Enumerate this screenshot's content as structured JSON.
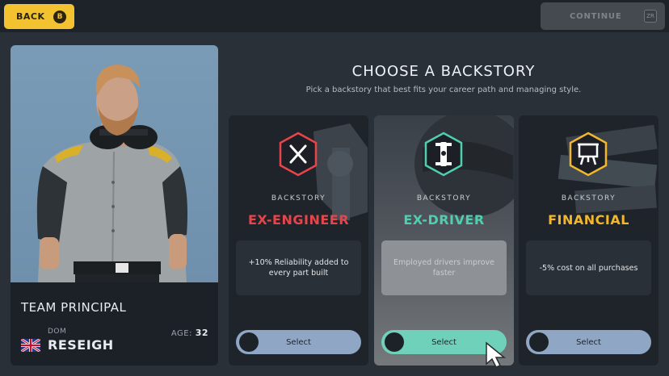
{
  "topbar": {
    "back_label": "BACK",
    "back_key": "B",
    "continue_label": "CONTINUE",
    "continue_key": "ZR"
  },
  "profile": {
    "role": "TEAM PRINCIPAL",
    "first_name": "DOM",
    "last_name": "RESEIGH",
    "age_label": "AGE:",
    "age_value": "32",
    "flag_icon": "uk-flag-icon"
  },
  "header": {
    "title": "CHOOSE A BACKSTORY",
    "subtitle": "Pick a backstory that best fits your career path and managing style."
  },
  "cards": [
    {
      "kicker": "BACKSTORY",
      "title": "EX-ENGINEER",
      "description": "+10% Reliability added to every part built",
      "button": "Select",
      "accent": "#e8454a",
      "icon": "tools-icon",
      "selected": false
    },
    {
      "kicker": "BACKSTORY",
      "title": "EX-DRIVER",
      "description": "Employed drivers improve faster",
      "button": "Select",
      "accent": "#4fcfae",
      "icon": "race-car-icon",
      "selected": true
    },
    {
      "kicker": "BACKSTORY",
      "title": "FINANCIAL",
      "description": "-5% cost on all purchases",
      "button": "Select",
      "accent": "#f2b72c",
      "icon": "presentation-chart-icon",
      "selected": false
    }
  ],
  "colors": {
    "background": "#2a3038",
    "back_button": "#f2c230",
    "select_button": "#8fa6c4",
    "select_button_active": "#6fd1ba"
  }
}
